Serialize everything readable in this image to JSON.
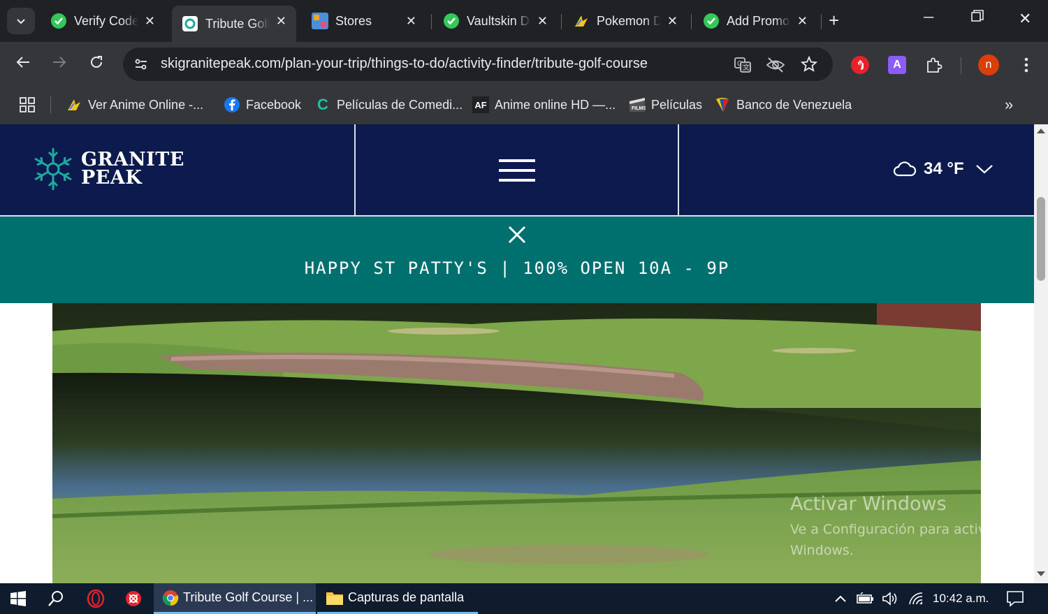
{
  "browser": {
    "tabs": [
      {
        "title": "Verify Code",
        "icon": "green-check-icon",
        "active": false
      },
      {
        "title": "Tribute Golf Course",
        "icon": "granite-peak-favicon",
        "active": true
      },
      {
        "title": "Stores",
        "icon": "stores-favicon",
        "active": false
      },
      {
        "title": "Vaultskin Downloads",
        "icon": "green-check-icon",
        "active": false
      },
      {
        "title": "Pokemon Dex",
        "icon": "anime-favicon",
        "active": false
      },
      {
        "title": "Add Promo",
        "icon": "green-check-icon",
        "active": false
      }
    ],
    "url": "skigranitepeak.com/plan-your-trip/things-to-do/activity-finder/tribute-golf-course",
    "profile_initial": "n",
    "extension_letter": "A",
    "bookmarks": [
      {
        "label": "Ver Anime Online -...",
        "icon": "anime-favicon"
      },
      {
        "label": "Facebook",
        "icon": "facebook-icon"
      },
      {
        "label": "Películas de Comedi...",
        "icon": "cuevana-favicon"
      },
      {
        "label": "Anime online HD —...",
        "icon": "af-favicon"
      },
      {
        "label": "Películas",
        "icon": "movies-favicon"
      },
      {
        "label": "Banco de Venezuela",
        "icon": "venezuela-bank-favicon"
      }
    ]
  },
  "site": {
    "logo_line1": "GRANITE",
    "logo_line2": "PEAK",
    "weather_temp": "34 °F",
    "alert_message": "HAPPY ST PATTY'S | 100% OPEN 10A - 9P",
    "colors": {
      "header": "#0c1a4d",
      "alert": "#00706f",
      "logo_accent": "#1fa9a0"
    }
  },
  "watermark": {
    "line1": "Activar Windows",
    "line2": "Ve a Configuración para activar Windows."
  },
  "taskbar": {
    "apps": [
      {
        "label": "Tribute Golf Course | ...",
        "icon": "chrome-icon"
      },
      {
        "label": "Capturas de pantalla",
        "icon": "folder-icon"
      }
    ],
    "time": "10:42 a.m."
  }
}
